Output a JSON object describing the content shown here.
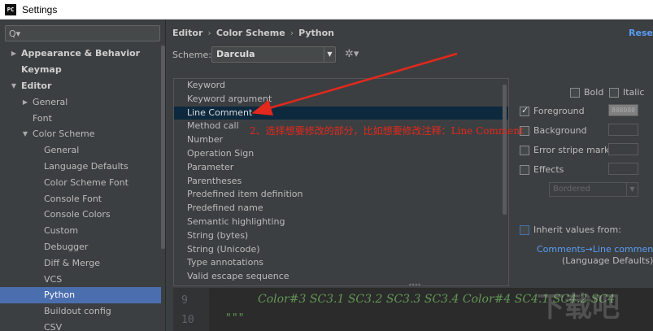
{
  "window": {
    "title": "Settings",
    "logo_text": "PC"
  },
  "search": {
    "icon": "search-icon",
    "placeholder": ""
  },
  "tree": [
    {
      "label": "Appearance & Behavior",
      "arrow": "▶",
      "indent": 0,
      "bold": true
    },
    {
      "label": "Keymap",
      "arrow": "",
      "indent": 0,
      "bold": true
    },
    {
      "label": "Editor",
      "arrow": "▼",
      "indent": 0,
      "bold": true
    },
    {
      "label": "General",
      "arrow": "▶",
      "indent": 1,
      "bold": false
    },
    {
      "label": "Font",
      "arrow": "",
      "indent": 1,
      "bold": false
    },
    {
      "label": "Color Scheme",
      "arrow": "▼",
      "indent": 1,
      "bold": false
    },
    {
      "label": "General",
      "arrow": "",
      "indent": 2,
      "bold": false
    },
    {
      "label": "Language Defaults",
      "arrow": "",
      "indent": 2,
      "bold": false
    },
    {
      "label": "Color Scheme Font",
      "arrow": "",
      "indent": 2,
      "bold": false
    },
    {
      "label": "Console Font",
      "arrow": "",
      "indent": 2,
      "bold": false
    },
    {
      "label": "Console Colors",
      "arrow": "",
      "indent": 2,
      "bold": false
    },
    {
      "label": "Custom",
      "arrow": "",
      "indent": 2,
      "bold": false
    },
    {
      "label": "Debugger",
      "arrow": "",
      "indent": 2,
      "bold": false
    },
    {
      "label": "Diff & Merge",
      "arrow": "",
      "indent": 2,
      "bold": false
    },
    {
      "label": "VCS",
      "arrow": "",
      "indent": 2,
      "bold": false
    },
    {
      "label": "Python",
      "arrow": "",
      "indent": 2,
      "bold": false,
      "selected": true
    },
    {
      "label": "Buildout config",
      "arrow": "",
      "indent": 2,
      "bold": false
    },
    {
      "label": "CSV",
      "arrow": "",
      "indent": 2,
      "bold": false
    }
  ],
  "breadcrumb": [
    "Editor",
    "Color Scheme",
    "Python"
  ],
  "breadcrumb_sep": "›",
  "reset_label": "Rese",
  "scheme": {
    "label": "Scheme:",
    "value": "Darcula"
  },
  "elements": [
    "Keyword",
    "Keyword argument",
    "Line Comment",
    "Method call",
    "Number",
    "Operation Sign",
    "Parameter",
    "Parentheses",
    "Predefined item definition",
    "Predefined name",
    "Semantic highlighting",
    "String (bytes)",
    "String (Unicode)",
    "Type annotations",
    "Valid escape sequence"
  ],
  "selected_element": "Line Comment",
  "options": {
    "bold": "Bold",
    "italic": "Italic",
    "foreground": "Foreground",
    "foreground_value": "808080",
    "background": "Background",
    "error_stripe": "Error stripe mark",
    "effects": "Effects",
    "effects_type": "Bordered",
    "inherit": "Inherit values from:",
    "inherit_link": "Comments→Line comment",
    "inherit_sub": "(Language Defaults)"
  },
  "preview": {
    "line9": "9",
    "line10": "10",
    "code9": "Color#3 SC3.1 SC3.2 SC3.3 SC3.4 Color#4 SC4.1 SC4.2 SC4",
    "code10": "\"\"\""
  },
  "annotation": "2、选择想要修改的部分，比如想要修改注释：Line Comment",
  "annotation_color": "#e3281c"
}
